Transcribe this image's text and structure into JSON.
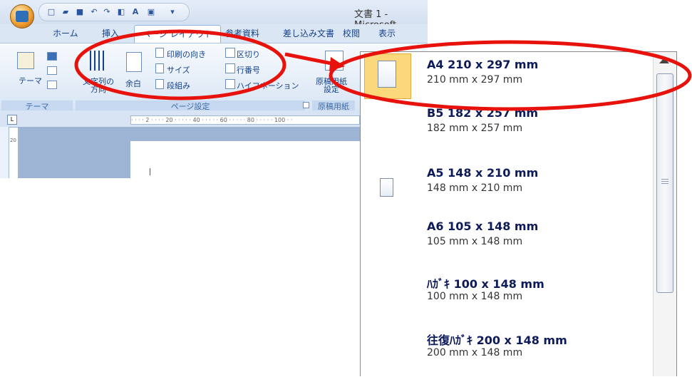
{
  "window": {
    "title": "文書 1 - Microsoft"
  },
  "quick_access": {
    "icons": [
      "new-document-icon",
      "open-folder-icon",
      "save-icon",
      "undo-icon",
      "redo-icon",
      "print-preview-icon",
      "spelling-icon",
      "paste-icon",
      "customize-dropdown-icon"
    ]
  },
  "tabs": [
    {
      "label": "ホーム"
    },
    {
      "label": "挿入"
    },
    {
      "label": "ページ レイアウト",
      "active": true
    },
    {
      "label": "参考資料"
    },
    {
      "label": "差し込み文書"
    },
    {
      "label": "校閲"
    },
    {
      "label": "表示"
    }
  ],
  "ribbon": {
    "theme_group": {
      "theme_button": "テーマ",
      "label": "テーマ"
    },
    "page_setup_group": {
      "text_direction": "文字列の\n方向",
      "margins": "余白",
      "orientation": "印刷の向き",
      "size": "サイズ",
      "columns": "段組み",
      "breaks": "区切り",
      "line_numbers": "行番号",
      "hyphenation": "ハイフネーション",
      "label": "ページ設定"
    },
    "manuscript_group": {
      "button": "原稿用紙\n設定",
      "label": "原稿用紙"
    }
  },
  "ruler": {
    "ticks": "· · · · 2 · · · · 20 · · · · · 40 · · · · · 60 · · · · · 80 · · · · · 100 · ·",
    "vertical_tick": "20"
  },
  "size_menu": {
    "items": [
      {
        "name": "A4 210 x 297 mm",
        "dims": "210 mm x 297 mm",
        "selected": true
      },
      {
        "name": "B5 182 x 257 mm",
        "dims": "182 mm x 257 mm"
      },
      {
        "name": "A5 148 x 210 mm",
        "dims": "148 mm x 210 mm"
      },
      {
        "name": "A6 105 x 148 mm",
        "dims": "105 mm x 148 mm"
      },
      {
        "name": "ﾊｶﾞｷ 100 x 148 mm",
        "dims": "100 mm x 148 mm"
      },
      {
        "name": "往復ﾊｶﾞｷ 200 x 148 mm",
        "dims": "200 mm x 148 mm"
      }
    ]
  },
  "annotation": {
    "color": "#e8120c"
  }
}
